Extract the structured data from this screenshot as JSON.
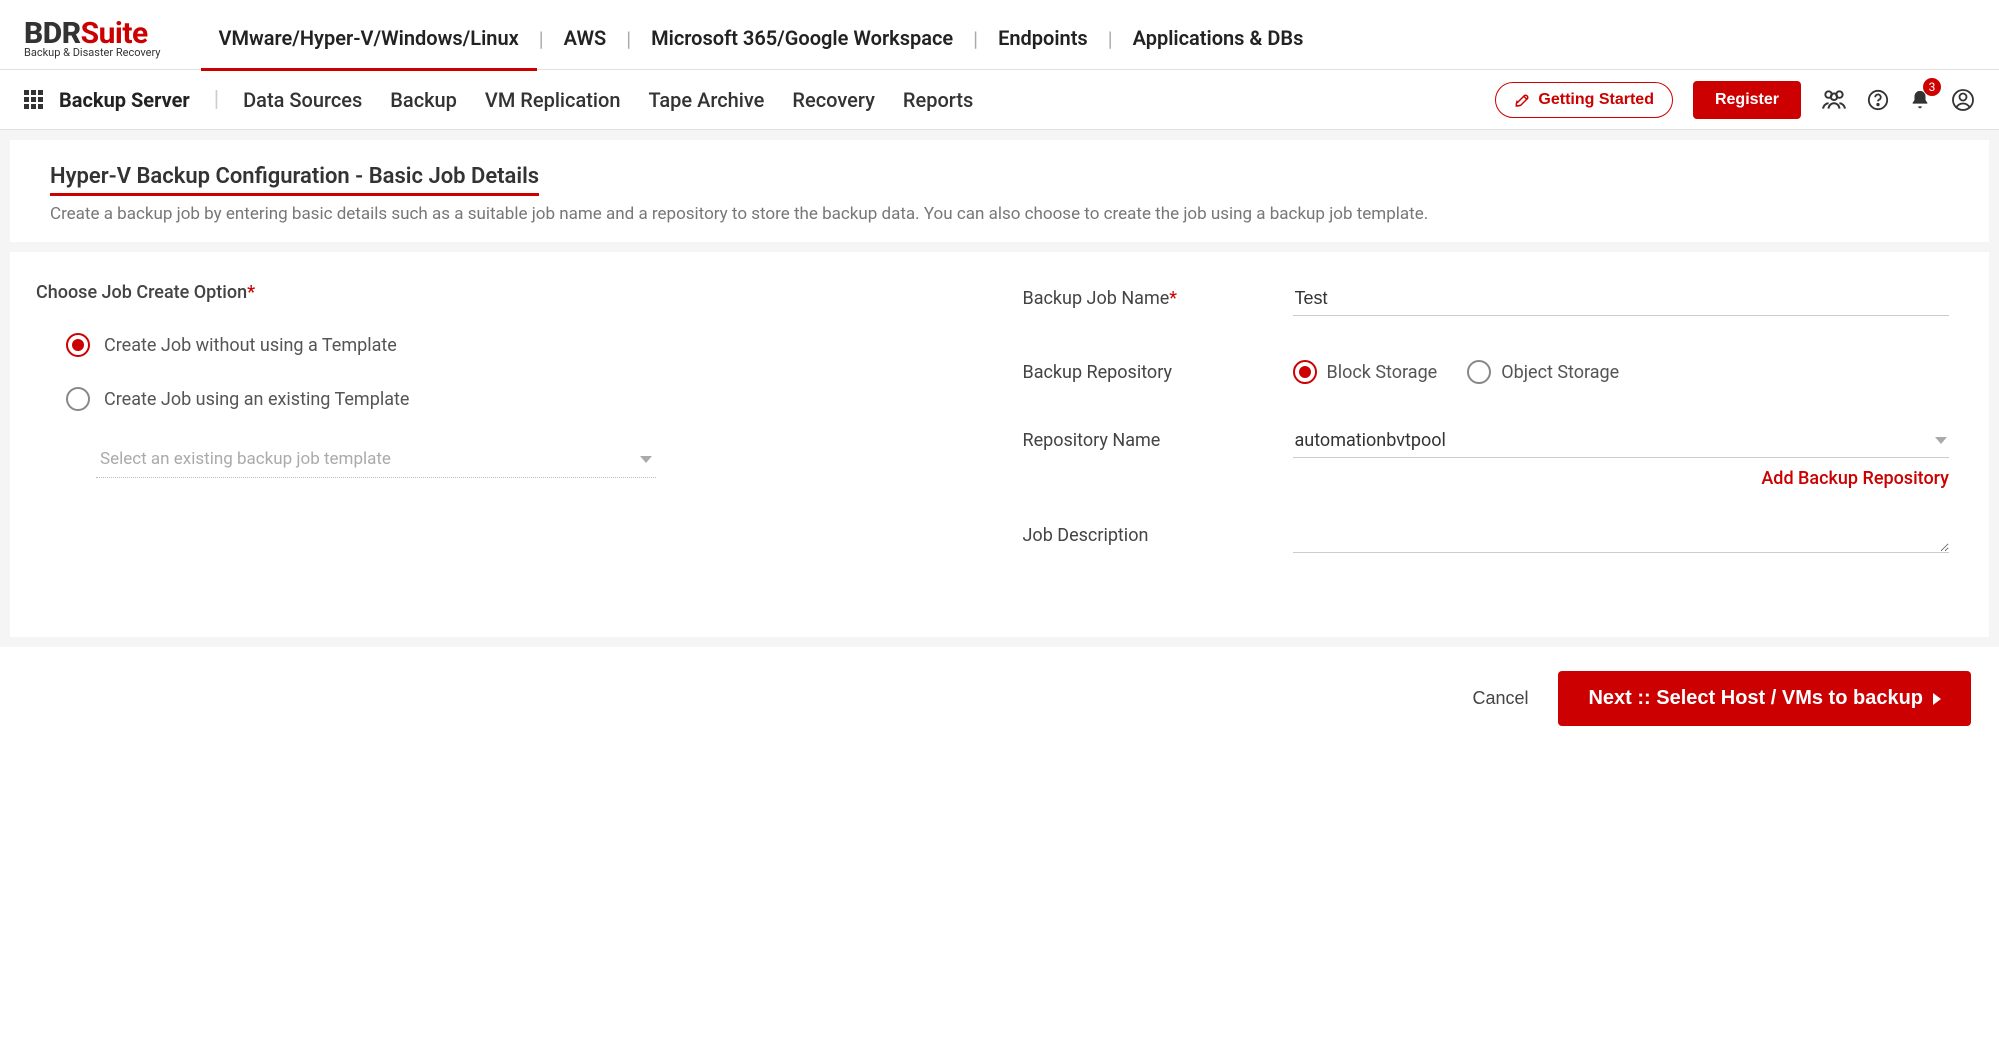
{
  "logo": {
    "text1": "BDR",
    "text2": "Suite",
    "sub": "Backup & Disaster Recovery"
  },
  "top_tabs": [
    "VMware/Hyper-V/Windows/Linux",
    "AWS",
    "Microsoft 365/Google Workspace",
    "Endpoints",
    "Applications & DBs"
  ],
  "sub_nav": {
    "server_label": "Backup Server",
    "items": [
      "Data Sources",
      "Backup",
      "VM Replication",
      "Tape Archive",
      "Recovery",
      "Reports"
    ],
    "getting_started": "Getting Started",
    "register": "Register",
    "notification_count": "3"
  },
  "page": {
    "title": "Hyper-V Backup Configuration - Basic Job Details",
    "description": "Create a backup job by entering basic details such as a suitable job name and a repository to store the backup data. You can also choose to create the job using a backup job template."
  },
  "form": {
    "choose_label": "Choose Job Create Option",
    "radio_no_template": "Create Job without using a Template",
    "radio_with_template": "Create Job using an existing Template",
    "template_placeholder": "Select an existing backup job template",
    "job_name_label": "Backup Job Name",
    "job_name_value": "Test",
    "repo_label": "Backup Repository",
    "repo_block": "Block Storage",
    "repo_object": "Object Storage",
    "repo_name_label": "Repository Name",
    "repo_name_value": "automationbvtpool",
    "add_repo": "Add Backup Repository",
    "job_desc_label": "Job Description",
    "job_desc_value": ""
  },
  "footer": {
    "cancel": "Cancel",
    "next": "Next :: Select Host / VMs to backup"
  }
}
